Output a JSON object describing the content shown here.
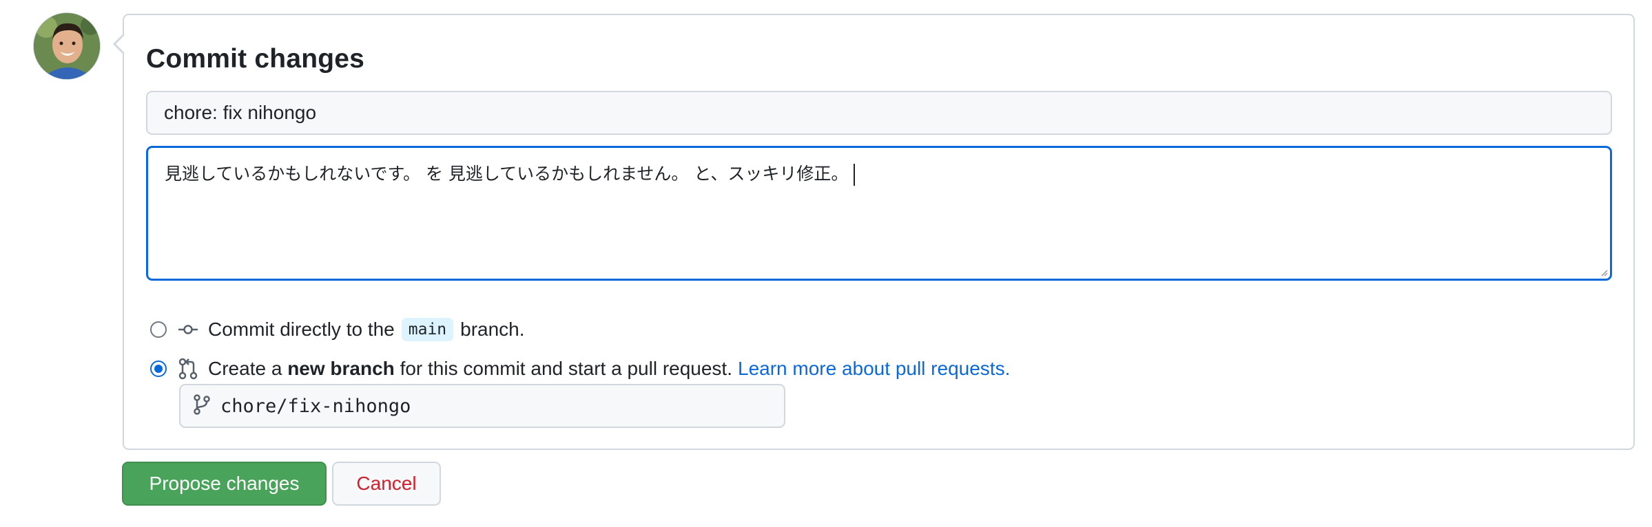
{
  "commit_panel": {
    "title": "Commit changes",
    "summary_value": "chore: fix nihongo",
    "description_value": "見逃しているかもしれないです。 を 見逃しているかもしれません。 と、スッキリ修正。",
    "options": {
      "direct": {
        "prefix": "Commit directly to the",
        "branch": "main",
        "suffix": "branch."
      },
      "new_branch": {
        "prefix": "Create a",
        "bold": "new branch",
        "suffix": "for this commit and start a pull request.",
        "link": "Learn more about pull requests."
      }
    },
    "branch_name_value": "chore/fix-nihongo",
    "selected_option": "new_branch"
  },
  "actions": {
    "propose_label": "Propose changes",
    "cancel_label": "Cancel"
  },
  "colors": {
    "accent": "#0969da",
    "primary_button": "#4aa35a",
    "cancel_text": "#cf222e"
  },
  "icons": [
    "avatar",
    "git-commit-icon",
    "git-pull-request-icon",
    "git-branch-icon",
    "resize-grip-icon"
  ]
}
